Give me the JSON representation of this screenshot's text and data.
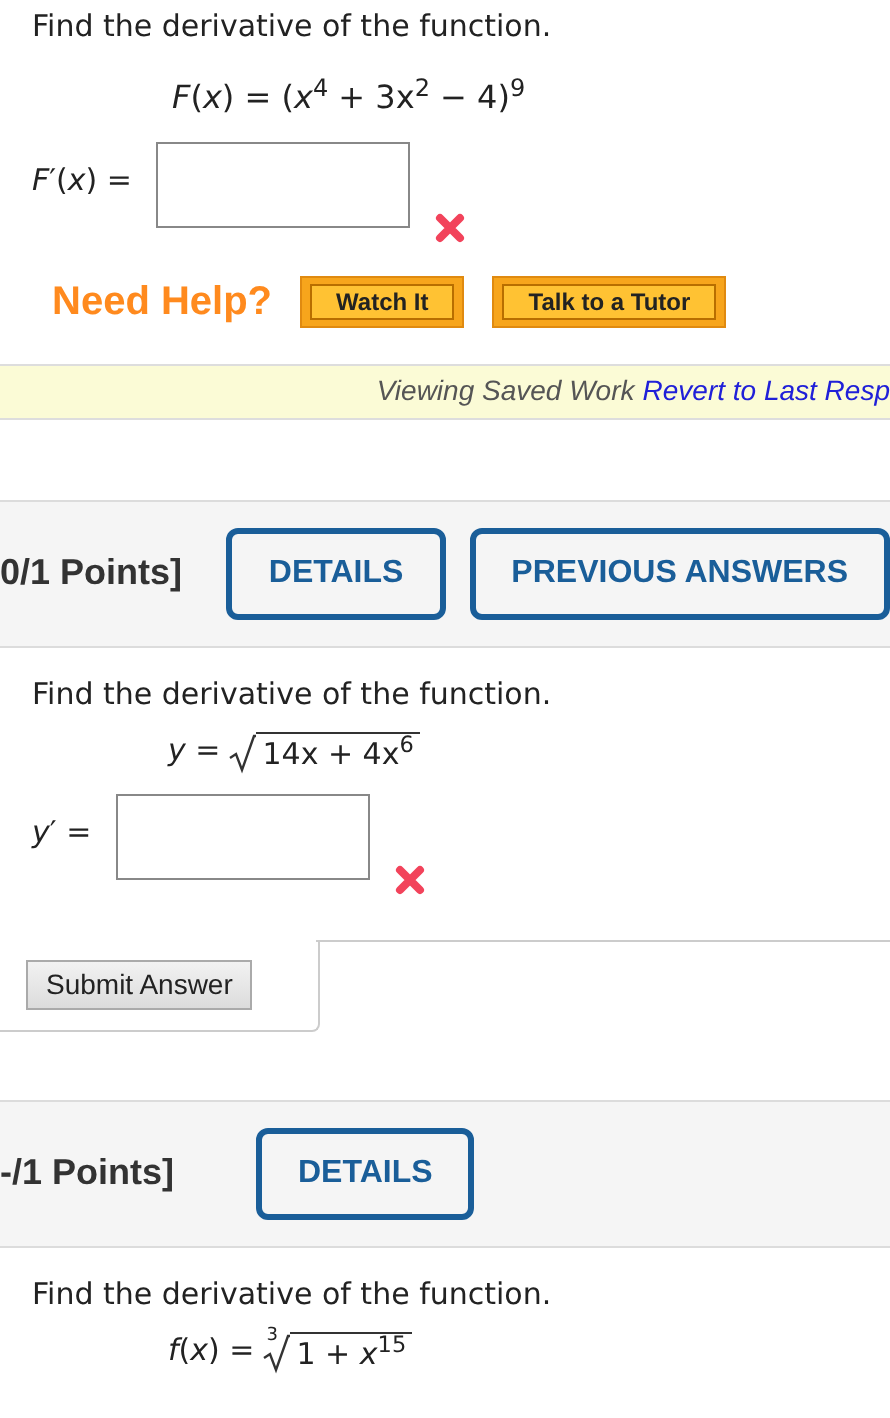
{
  "questions": [
    {
      "prompt": "Find the derivative of the function.",
      "formula": {
        "kind": "plain",
        "text": "*F*(*x*) = (*x*$^{4}$ + 3x$^{2}$ − 4)$^{9}$"
      },
      "answer_label": "*F*′(*x*) =",
      "incorrect": true,
      "need_help": {
        "label": "Need Help?",
        "buttons": [
          "Watch It",
          "Talk to a Tutor"
        ]
      },
      "notice": {
        "text": "Viewing Saved Work",
        "link": "Revert to Last Resp"
      }
    },
    {
      "header": {
        "points": "0/1 Points]",
        "buttons": [
          "DETAILS",
          "PREVIOUS ANSWERS"
        ]
      },
      "prompt": "Find the derivative of the function.",
      "formula": {
        "kind": "root",
        "lhs": "*y* =",
        "radicand": "14x + 4x$^{6}$"
      },
      "answer_label": "*y*′ =",
      "incorrect": true,
      "submit": "Submit Answer"
    },
    {
      "header": {
        "points": "-/1 Points]",
        "buttons": [
          "DETAILS"
        ]
      },
      "prompt": "Find the derivative of the function.",
      "formula": {
        "kind": "root",
        "lhs": "*f*(*x*) =",
        "index": "3",
        "radicand": "1 + *x*$^{15}$"
      }
    }
  ]
}
